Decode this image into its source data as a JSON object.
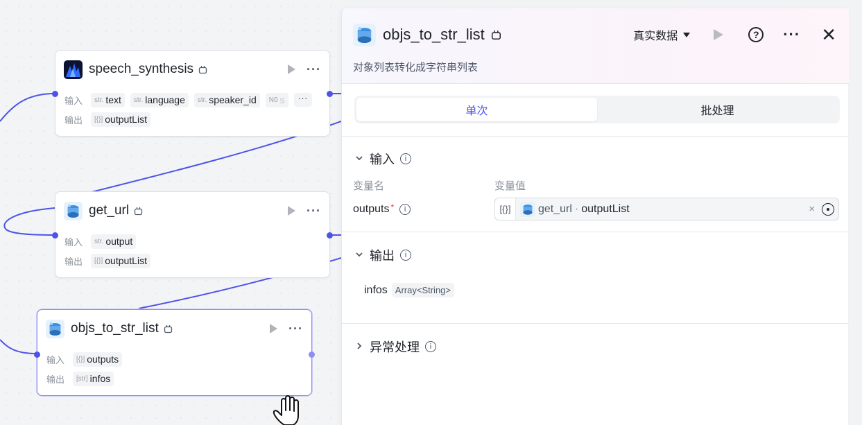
{
  "canvas": {
    "nodes": [
      {
        "title": "speech_synthesis",
        "icon": "speech-synthesis-icon",
        "inputs_label": "输入",
        "outputs_label": "输出",
        "inputs": [
          {
            "type": "str.",
            "name": "text"
          },
          {
            "type": "str.",
            "name": "language"
          },
          {
            "type": "str.",
            "name": "speaker_id"
          },
          {
            "type": "N0",
            "name": "s"
          }
        ],
        "more": "···",
        "outputs": [
          {
            "type": "[{}]",
            "name": "outputList"
          }
        ]
      },
      {
        "title": "get_url",
        "icon": "plugin-icon",
        "inputs_label": "输入",
        "outputs_label": "输出",
        "inputs": [
          {
            "type": "str.",
            "name": "output"
          }
        ],
        "outputs": [
          {
            "type": "[{}]",
            "name": "outputList"
          }
        ]
      },
      {
        "title": "objs_to_str_list",
        "icon": "plugin-icon",
        "inputs_label": "输入",
        "outputs_label": "输出",
        "inputs": [
          {
            "type": "[{}]",
            "name": "outputs"
          }
        ],
        "outputs": [
          {
            "type": "[str]",
            "name": "infos"
          }
        ]
      }
    ]
  },
  "panel": {
    "title": "objs_to_str_list",
    "description": "对象列表转化成字符串列表",
    "mode": "真实数据",
    "tabs": [
      "单次",
      "批处理"
    ],
    "active_tab": 0,
    "input_section": {
      "title": "输入",
      "col_name": "变量名",
      "col_value": "变量值",
      "var_name": "outputs",
      "required_mark": "*",
      "value_type": "[{}]",
      "value_node": "get_url",
      "value_sep": "·",
      "value_field": "outputList",
      "clear": "×"
    },
    "output_section": {
      "title": "输出",
      "name": "infos",
      "type": "Array<String>"
    },
    "error_section": {
      "title": "异常处理"
    }
  },
  "colors": {
    "accent": "#4d53e8",
    "edge": "#4d53e8",
    "selected_border": "#8c8ff0"
  }
}
